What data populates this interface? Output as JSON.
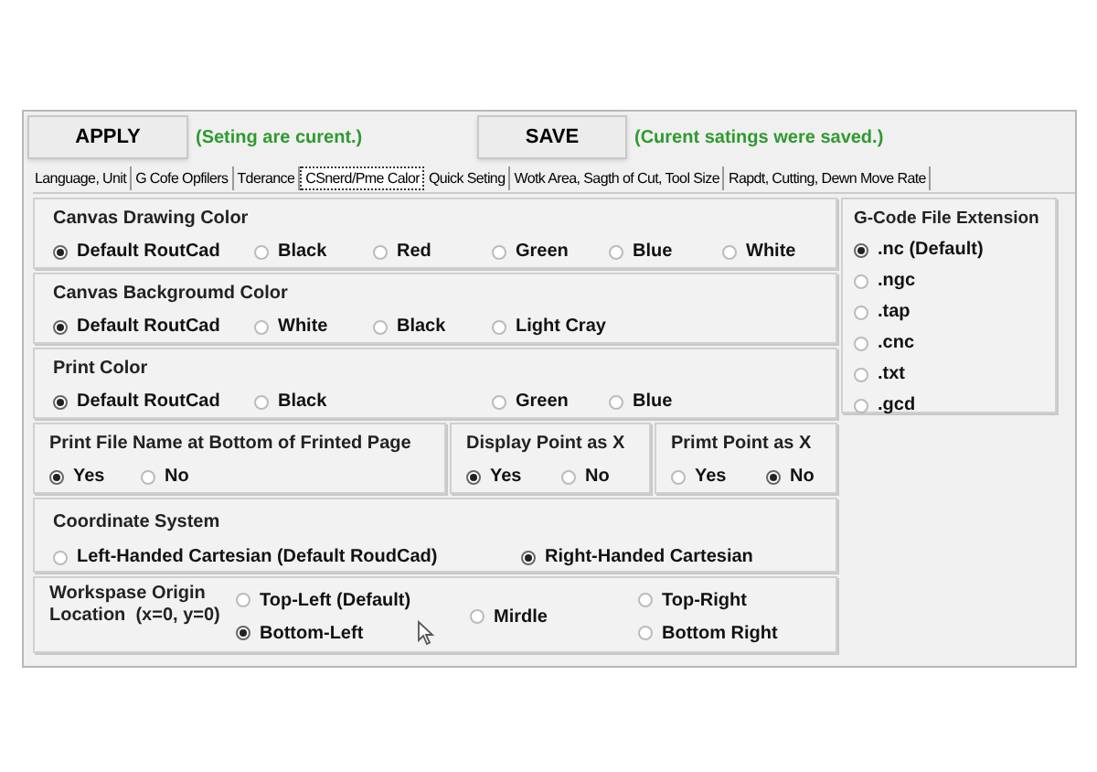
{
  "toolbar": {
    "apply_button": "APPLY",
    "apply_status": "(Seting  are curent.)",
    "save_button": "SAVE",
    "save_status": "(Curent satings were saved.)"
  },
  "tabs": [
    {
      "label": "Language,  Unit",
      "selected": false
    },
    {
      "label": "G Cofe Opfilers",
      "selected": false
    },
    {
      "label": "Tderance",
      "selected": false
    },
    {
      "label": "CSnerd/Pme Calor",
      "selected": true
    },
    {
      "label": "Quick Seting",
      "selected": false
    },
    {
      "label": "Wotk Area, Sagth of Cut, Tool Size",
      "selected": false
    },
    {
      "label": "Rapdt, Cutting, Dewn Move Rate",
      "selected": false
    }
  ],
  "groups": [
    {
      "title": "Canvas Drawing Color",
      "options": [
        {
          "label": "Default RoutCad",
          "selected": true
        },
        {
          "label": "Black",
          "selected": false
        },
        {
          "label": "Red",
          "selected": false
        },
        {
          "label": "Green",
          "selected": false
        },
        {
          "label": "Blue",
          "selected": false
        },
        {
          "label": "White",
          "selected": false
        }
      ]
    },
    {
      "title": "Canvas Backgroumd Color",
      "options": [
        {
          "label": "Default RoutCad",
          "selected": true
        },
        {
          "label": "White",
          "selected": false
        },
        {
          "label": "Black",
          "selected": false
        },
        {
          "label": "Light Cray",
          "selected": false
        }
      ]
    },
    {
      "title": "Print Color",
      "options": [
        {
          "label": "Default RoutCad",
          "selected": true
        },
        {
          "label": "Black",
          "selected": false
        },
        {
          "label": "Green",
          "selected": false
        },
        {
          "label": "Blue",
          "selected": false
        }
      ]
    }
  ],
  "small_groups": [
    {
      "title": "Print File Name at Bottom of Frinted Page",
      "options": [
        {
          "label": "Yes",
          "selected": true
        },
        {
          "label": "No",
          "selected": false
        }
      ]
    },
    {
      "title": "Display Point as X",
      "options": [
        {
          "label": "Yes",
          "selected": true
        },
        {
          "label": "No",
          "selected": false
        }
      ]
    },
    {
      "title": "Primt Point as X",
      "options": [
        {
          "label": "Yes",
          "selected": false
        },
        {
          "label": "No",
          "selected": true
        }
      ]
    }
  ],
  "coordinate_system": {
    "title": "Coordinate System",
    "options": [
      {
        "label": "Left-Handed Cartesian (Default RoudCad)",
        "selected": false
      },
      {
        "label": "Right-Handed Cartesian",
        "selected": true
      }
    ]
  },
  "workspace_origin": {
    "title": "Workspase Origin\nLocation  (x=0, y=0)",
    "options": [
      {
        "label": "Top-Left (Default)",
        "selected": false
      },
      {
        "label": "Bottom-Left",
        "selected": true
      },
      {
        "label": "Mirdle",
        "selected": false
      },
      {
        "label": "Top-Right",
        "selected": false
      },
      {
        "label": "Bottom Right",
        "selected": false
      }
    ]
  },
  "gcode_extension": {
    "title": "G-Code File Extension",
    "options": [
      {
        "label": ".nc (Default)",
        "selected": true
      },
      {
        "label": ".ngc",
        "selected": false
      },
      {
        "label": ".tap",
        "selected": false
      },
      {
        "label": ".cnc",
        "selected": false
      },
      {
        "label": ".txt",
        "selected": false
      },
      {
        "label": ".gcd",
        "selected": false
      }
    ]
  }
}
